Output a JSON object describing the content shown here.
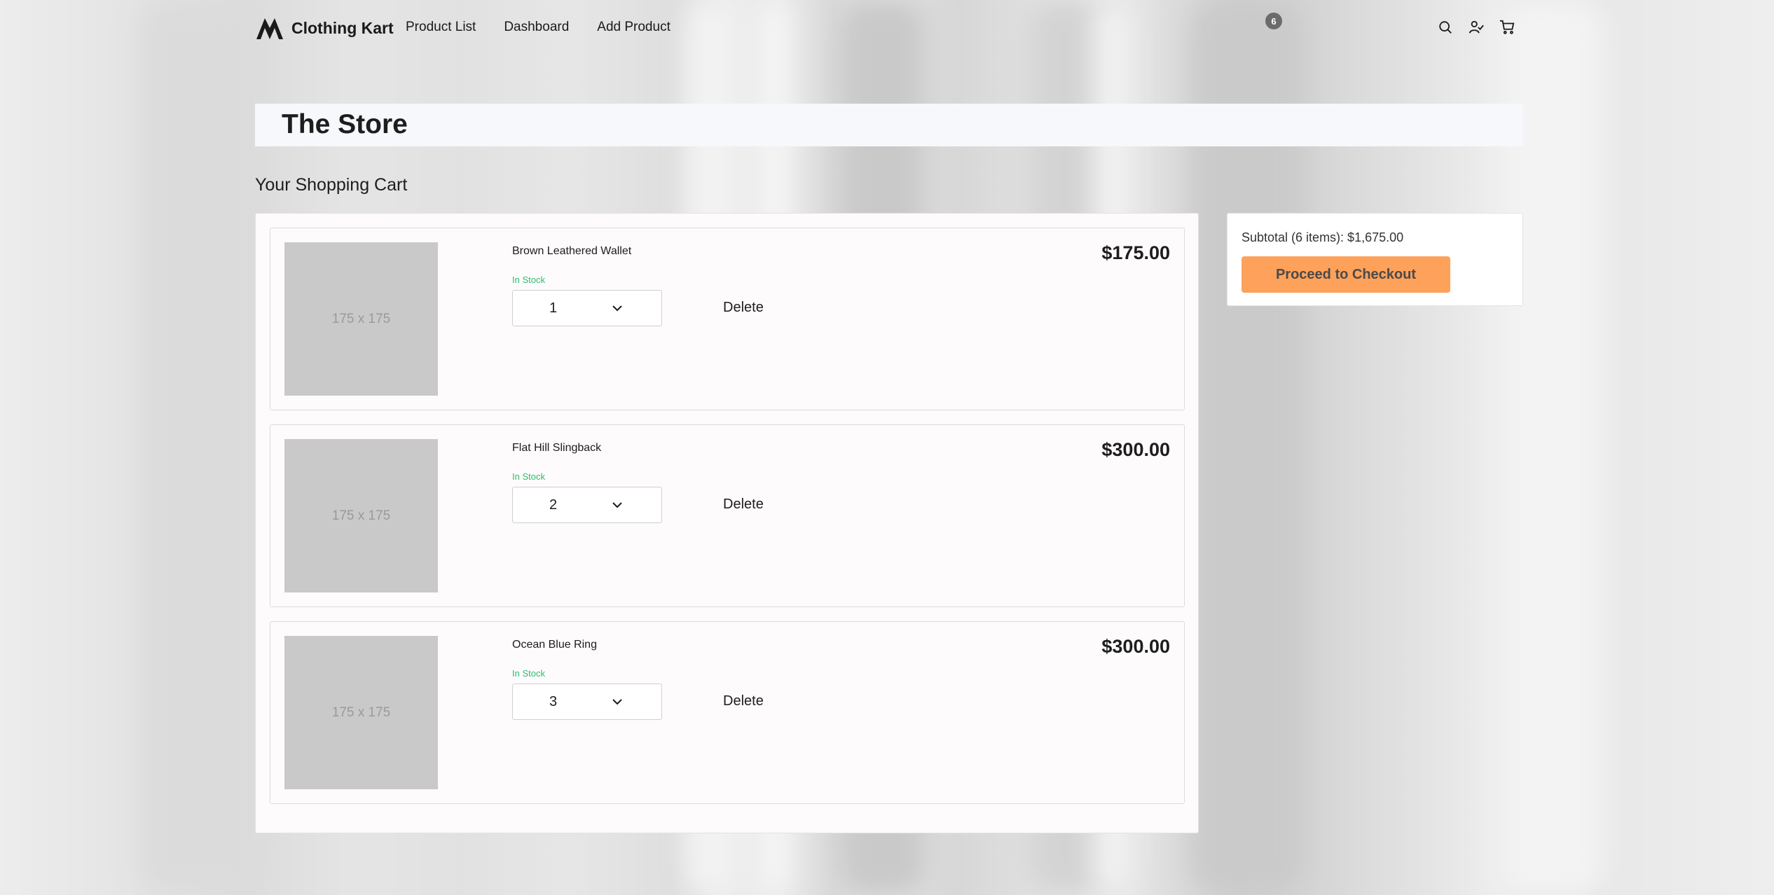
{
  "header": {
    "logo_text": "Clothing Kart",
    "nav": [
      "Product List",
      "Dashboard",
      "Add Product"
    ],
    "cart_count": "6",
    "icons": [
      "search-icon",
      "user-check-icon",
      "cart-icon"
    ]
  },
  "banner": {
    "title": "The Store"
  },
  "cart": {
    "title": "Your Shopping Cart",
    "delete_label": "Delete",
    "items": [
      {
        "name": "Brown Leathered Wallet",
        "stock": "In Stock",
        "qty": "1",
        "price": "$175.00",
        "image_placeholder": "175 x 175"
      },
      {
        "name": "Flat Hill Slingback",
        "stock": "In Stock",
        "qty": "2",
        "price": "$300.00",
        "image_placeholder": "175 x 175"
      },
      {
        "name": "Ocean Blue Ring",
        "stock": "In Stock",
        "qty": "3",
        "price": "$300.00",
        "image_placeholder": "175 x 175"
      }
    ]
  },
  "summary": {
    "subtotal": "Subtotal (6 items): $1,675.00",
    "checkout_label": "Proceed to Checkout"
  },
  "colors": {
    "accent": "#fea15b",
    "in_stock": "#2dbd6e",
    "badge": "#6b6b6b"
  }
}
